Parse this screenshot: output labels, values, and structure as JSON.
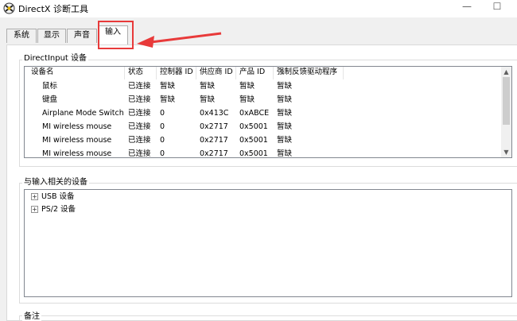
{
  "window": {
    "title": "DirectX 诊断工具",
    "minimize_glyph": "—",
    "maximize_glyph": "☐"
  },
  "tabs": [
    {
      "label": "系统"
    },
    {
      "label": "显示"
    },
    {
      "label": "声音"
    },
    {
      "label": "输入"
    }
  ],
  "directinput": {
    "group_label": "DirectInput 设备",
    "columns": [
      "设备名",
      "状态",
      "控制器 ID",
      "供应商 ID",
      "产品 ID",
      "强制反馈驱动程序"
    ],
    "rows": [
      [
        "鼠标",
        "已连接",
        "暂缺",
        "暂缺",
        "暂缺",
        "暂缺"
      ],
      [
        "键盘",
        "已连接",
        "暂缺",
        "暂缺",
        "暂缺",
        "暂缺"
      ],
      [
        "Airplane Mode Switch",
        "已连接",
        "0",
        "0x413C",
        "0xABCE",
        "暂缺"
      ],
      [
        "MI wireless mouse",
        "已连接",
        "0",
        "0x2717",
        "0x5001",
        "暂缺"
      ],
      [
        "MI wireless mouse",
        "已连接",
        "0",
        "0x2717",
        "0x5001",
        "暂缺"
      ],
      [
        "MI wireless mouse",
        "已连接",
        "0",
        "0x2717",
        "0x5001",
        "暂缺"
      ]
    ]
  },
  "related": {
    "group_label": "与输入相关的设备",
    "items": [
      {
        "expander": "+",
        "label": "USB 设备"
      },
      {
        "expander": "+",
        "label": "PS/2 设备"
      }
    ]
  },
  "notes": {
    "group_label": "备注"
  }
}
